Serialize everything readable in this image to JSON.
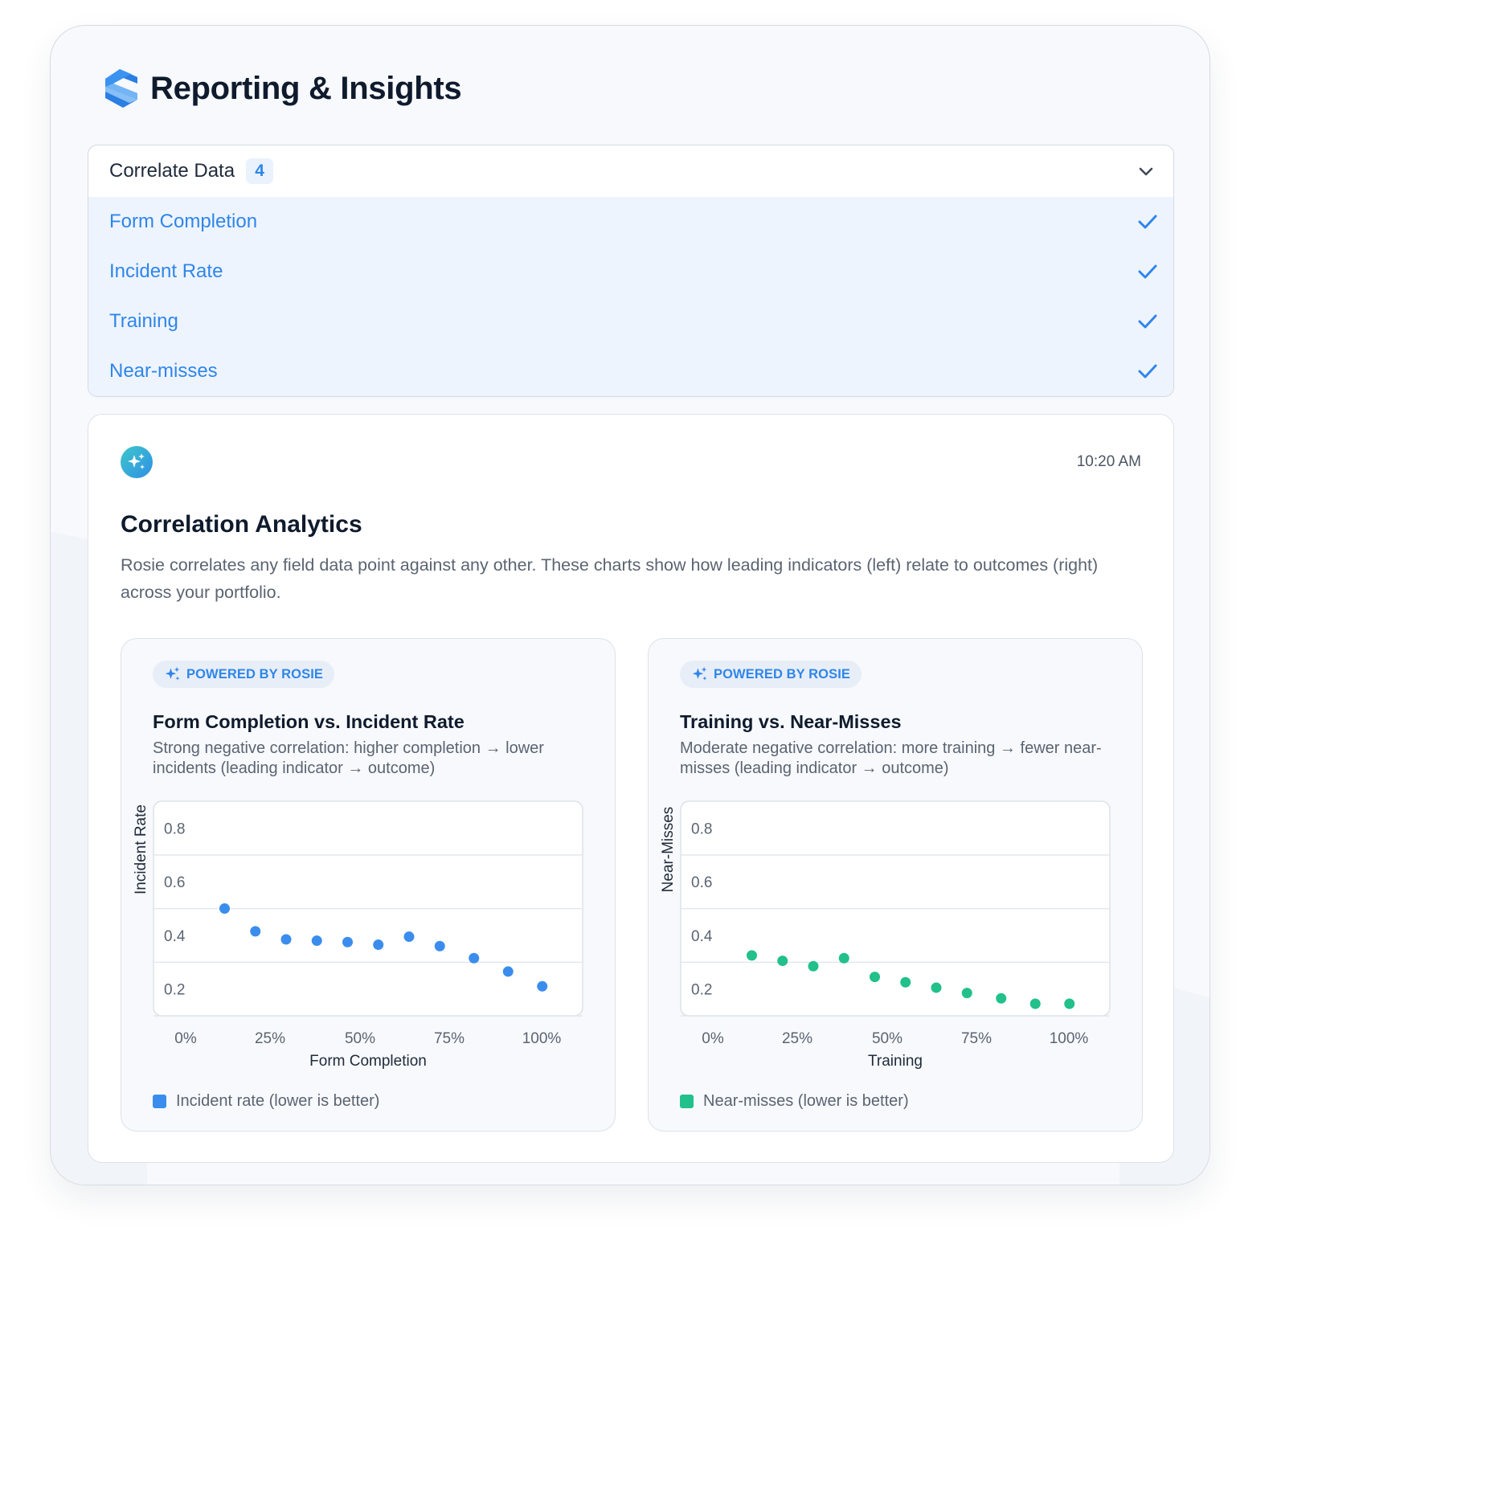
{
  "header": {
    "title": "Reporting & Insights",
    "logo_icon": "brand-logo-icon"
  },
  "select": {
    "title": "Correlate Data",
    "count": "4",
    "options": [
      {
        "label": "Form Completion",
        "checked": true
      },
      {
        "label": "Incident Rate",
        "checked": true
      },
      {
        "label": "Training",
        "checked": true
      },
      {
        "label": "Near-misses",
        "checked": true
      }
    ]
  },
  "card": {
    "timestamp": "10:20 AM",
    "title": "Correlation Analytics",
    "description": "Rosie correlates any field data point against any other. These charts show how leading indicators (left) relate to outcomes (right) across your portfolio."
  },
  "colors": {
    "accent": "#2f86ea",
    "blue_series": "#3b8ded",
    "green_series": "#22c08a"
  },
  "chart_data": [
    {
      "type": "scatter",
      "badge": "POWERED BY ROSIE",
      "title": "Form Completion vs. Incident Rate",
      "subtitle": "Strong negative correlation: higher completion → lower incidents (leading indicator → outcome)",
      "xlabel": "Form Completion",
      "ylabel": "Incident Rate",
      "x_ticks": [
        "0%",
        "25%",
        "50%",
        "75%",
        "100%"
      ],
      "y_ticks": [
        "0.8",
        "0.6",
        "0.4",
        "0.2"
      ],
      "xlim": [
        0,
        100
      ],
      "ylim": [
        0.1,
        0.9
      ],
      "grid": true,
      "legend": "bottom-left",
      "color": "#3b8ded",
      "series": [
        {
          "name": "Incident rate (lower is better)",
          "points": [
            {
              "x": 10,
              "y": 0.5
            },
            {
              "x": 19,
              "y": 0.415
            },
            {
              "x": 28,
              "y": 0.385
            },
            {
              "x": 37,
              "y": 0.38
            },
            {
              "x": 46,
              "y": 0.375
            },
            {
              "x": 55,
              "y": 0.365
            },
            {
              "x": 64,
              "y": 0.395
            },
            {
              "x": 73,
              "y": 0.36
            },
            {
              "x": 83,
              "y": 0.315
            },
            {
              "x": 93,
              "y": 0.265
            },
            {
              "x": 103,
              "y": 0.21
            }
          ]
        }
      ]
    },
    {
      "type": "scatter",
      "badge": "POWERED BY ROSIE",
      "title": "Training vs. Near-Misses",
      "subtitle": "Moderate negative correlation: more training → fewer near-misses (leading indicator → outcome)",
      "xlabel": "Training",
      "ylabel": "Near-Misses",
      "x_ticks": [
        "0%",
        "25%",
        "50%",
        "75%",
        "100%"
      ],
      "y_ticks": [
        "0.8",
        "0.6",
        "0.4",
        "0.2"
      ],
      "xlim": [
        0,
        100
      ],
      "ylim": [
        0.1,
        0.9
      ],
      "grid": true,
      "legend": "bottom-left",
      "color": "#22c08a",
      "series": [
        {
          "name": "Near-misses (lower is better)",
          "points": [
            {
              "x": 10,
              "y": 0.325
            },
            {
              "x": 19,
              "y": 0.305
            },
            {
              "x": 28,
              "y": 0.285
            },
            {
              "x": 37,
              "y": 0.315
            },
            {
              "x": 46,
              "y": 0.245
            },
            {
              "x": 55,
              "y": 0.225
            },
            {
              "x": 64,
              "y": 0.205
            },
            {
              "x": 73,
              "y": 0.185
            },
            {
              "x": 83,
              "y": 0.165
            },
            {
              "x": 93,
              "y": 0.145
            },
            {
              "x": 103,
              "y": 0.145
            }
          ]
        }
      ]
    }
  ]
}
